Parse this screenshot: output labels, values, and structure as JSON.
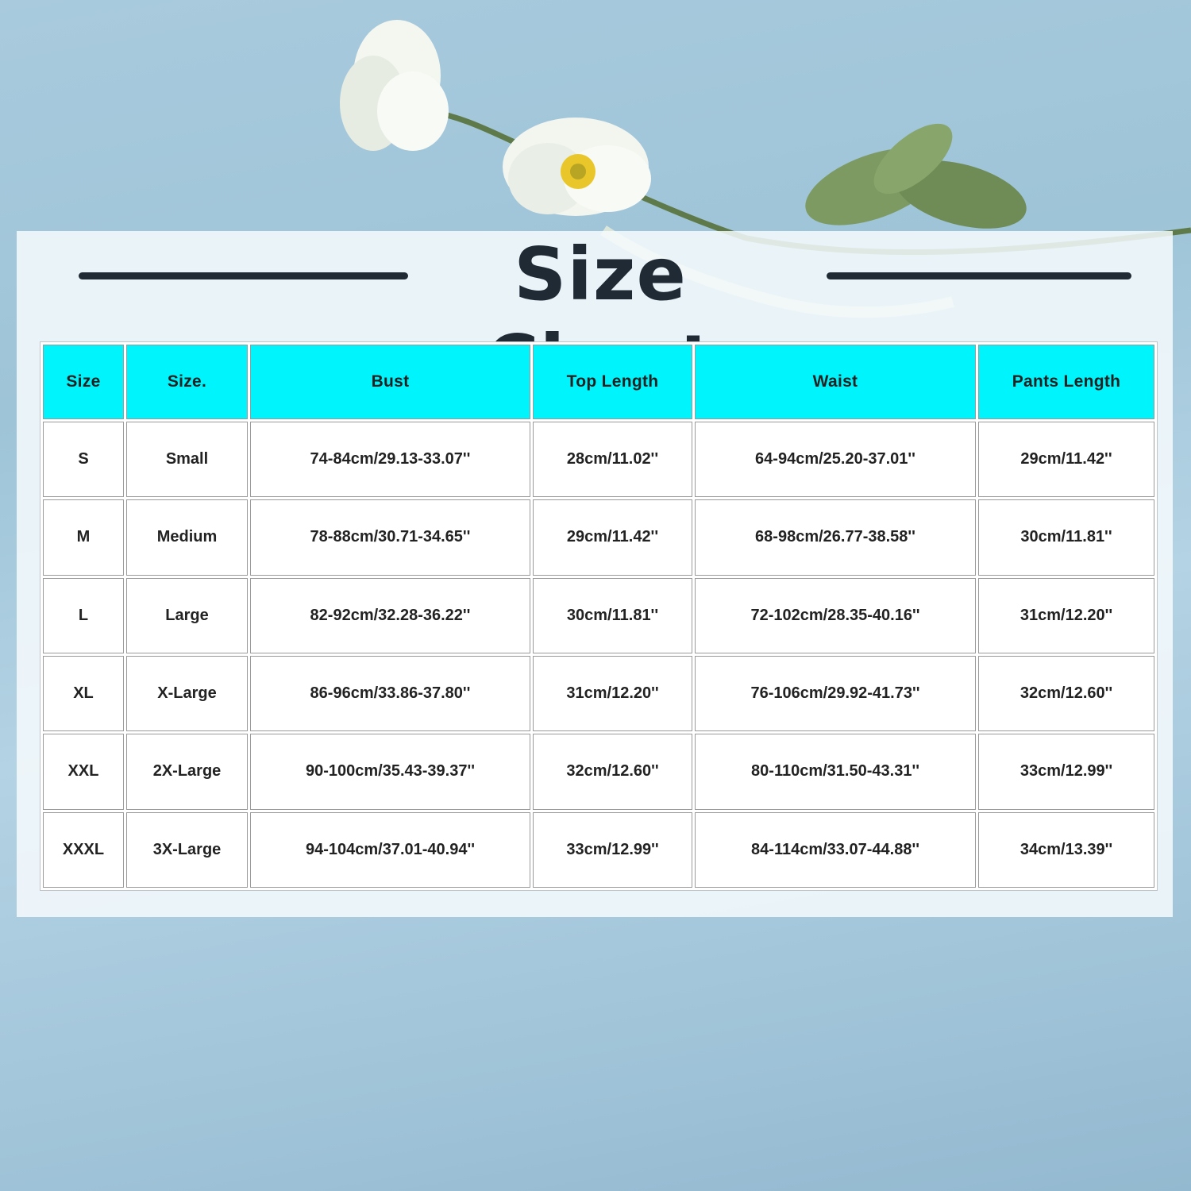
{
  "title": "Size Chart",
  "colors": {
    "header_fill": "#00f4fb",
    "title_text": "#1f2a35",
    "background": "#a9cadd"
  },
  "table": {
    "headers": [
      "Size",
      "Size.",
      "Bust",
      "Top Length",
      "Waist",
      "Pants Length"
    ],
    "rows": [
      [
        "S",
        "Small",
        "74-84cm/29.13-33.07''",
        "28cm/11.02''",
        "64-94cm/25.20-37.01''",
        "29cm/11.42''"
      ],
      [
        "M",
        "Medium",
        "78-88cm/30.71-34.65''",
        "29cm/11.42''",
        "68-98cm/26.77-38.58''",
        "30cm/11.81''"
      ],
      [
        "L",
        "Large",
        "82-92cm/32.28-36.22''",
        "30cm/11.81''",
        "72-102cm/28.35-40.16''",
        "31cm/12.20''"
      ],
      [
        "XL",
        "X-Large",
        "86-96cm/33.86-37.80''",
        "31cm/12.20''",
        "76-106cm/29.92-41.73''",
        "32cm/12.60''"
      ],
      [
        "XXL",
        "2X-Large",
        "90-100cm/35.43-39.37''",
        "32cm/12.60''",
        "80-110cm/31.50-43.31''",
        "33cm/12.99''"
      ],
      [
        "XXXL",
        "3X-Large",
        "94-104cm/37.01-40.94''",
        "33cm/12.99''",
        "84-114cm/33.07-44.88''",
        "34cm/13.39''"
      ]
    ]
  }
}
